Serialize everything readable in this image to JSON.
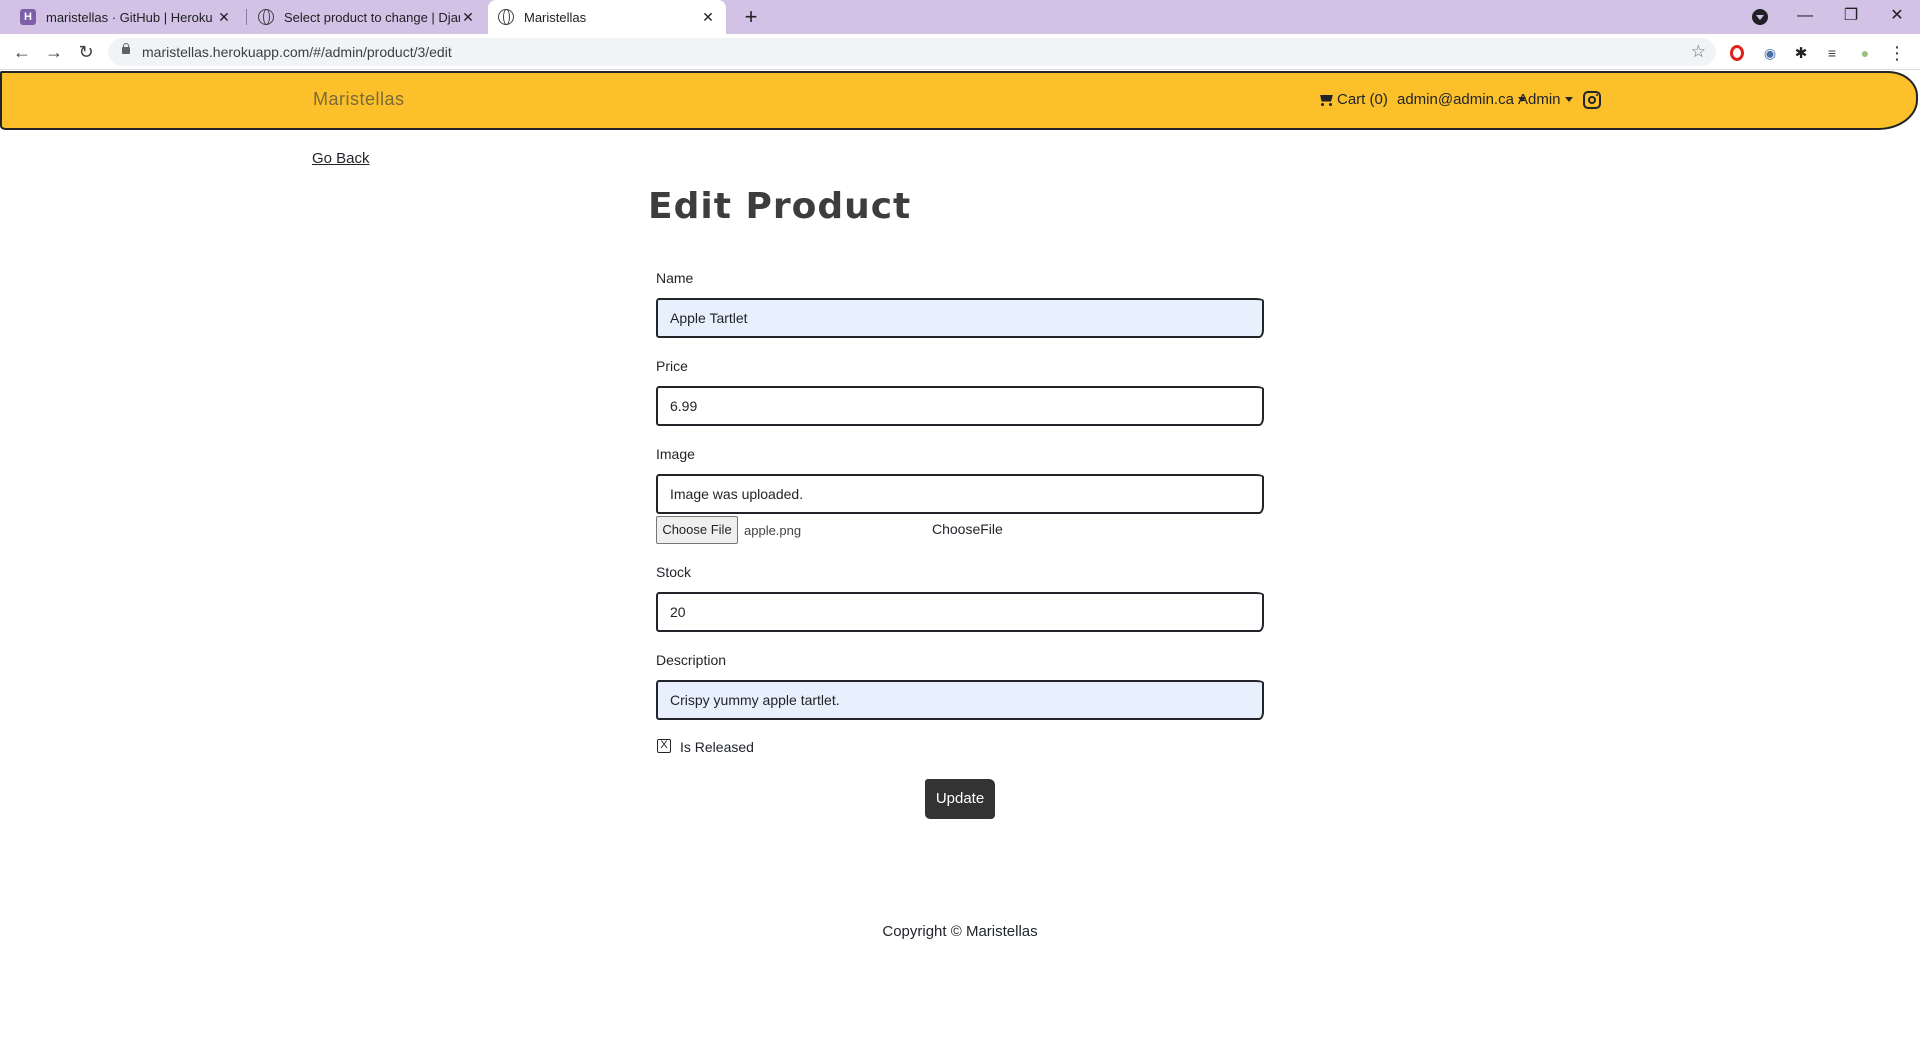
{
  "browser": {
    "tabs": [
      {
        "title": "maristellas · GitHub | Heroku",
        "favicon": "heroku-icon"
      },
      {
        "title": "Select product to change | Djang",
        "favicon": "globe-icon"
      },
      {
        "title": "Maristellas",
        "favicon": "globe-icon",
        "active": true
      }
    ],
    "new_tab": "+",
    "url": "maristellas.herokuapp.com/#/admin/product/3/edit",
    "controls": {
      "minimize": "—",
      "maximize": "❐",
      "close": "✕"
    },
    "nav": {
      "back": "←",
      "forward": "→",
      "reload": "↻"
    },
    "bookmark_star": "☆",
    "menu": "⋮"
  },
  "header": {
    "brand": "Maristellas",
    "cart": "Cart (0)",
    "user": "admin@admin.ca",
    "admin": "Admin",
    "color": "#fcc02a"
  },
  "page": {
    "go_back": "Go Back",
    "title": "Edit Product"
  },
  "form": {
    "name": {
      "label": "Name",
      "value": "Apple Tartlet"
    },
    "price": {
      "label": "Price",
      "value": "6.99"
    },
    "image": {
      "label": "Image",
      "value": "Image was uploaded.",
      "choose_button": "Choose File",
      "file_name": "apple.png",
      "choose_label": "ChooseFile"
    },
    "stock": {
      "label": "Stock",
      "value": "20"
    },
    "description": {
      "label": "Description",
      "value": "Crispy yummy apple tartlet."
    },
    "is_released": {
      "label": "Is Released",
      "checked": true,
      "mark": "X"
    },
    "submit": "Update"
  },
  "footer": {
    "copyright": "Copyright © Maristellas"
  }
}
